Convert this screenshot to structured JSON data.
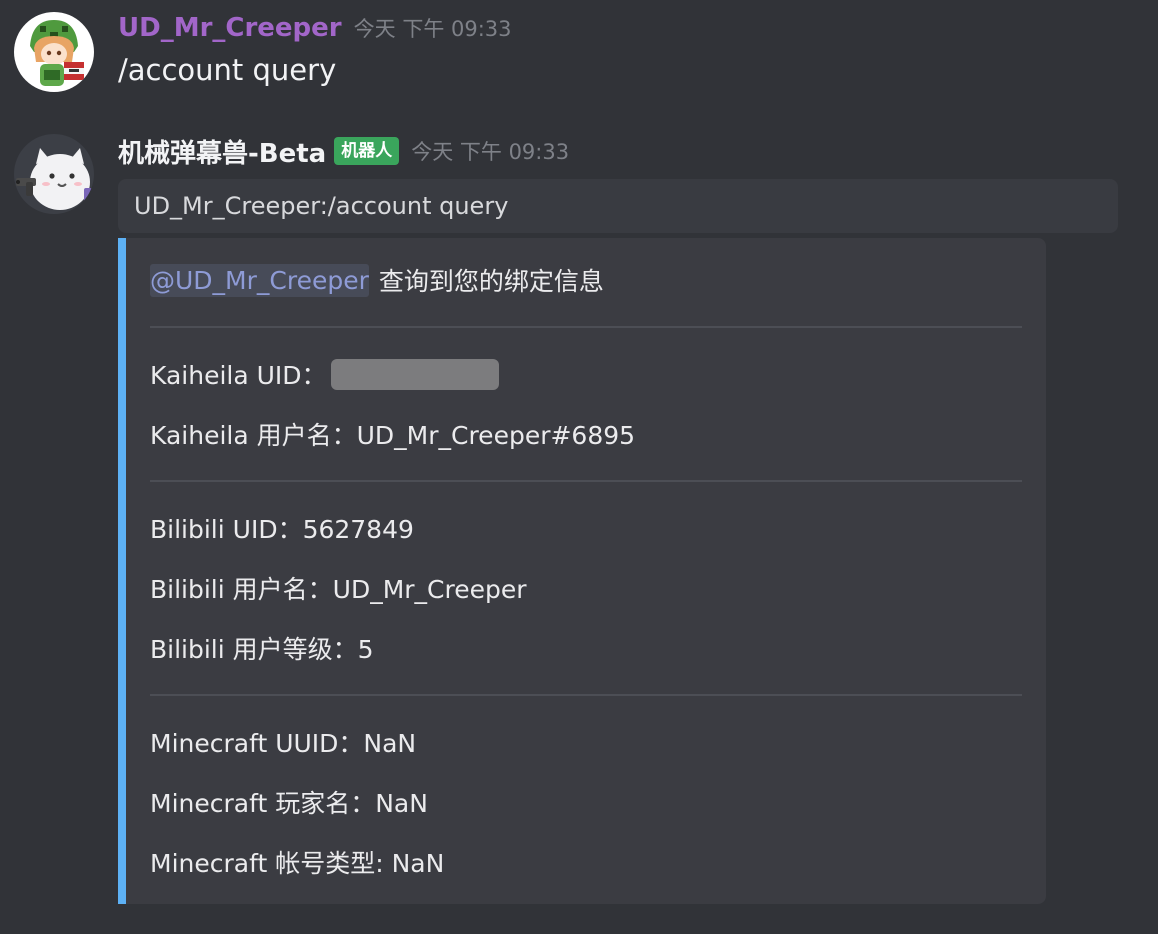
{
  "messages": [
    {
      "username": "UD_Mr_Creeper",
      "time": "今天 下午 09:33",
      "text": "/account query",
      "avatar_icon": "creeper-anime-avatar-icon"
    },
    {
      "username": "机械弹幕兽-Beta",
      "bot_tag": "机器人",
      "time": "今天 下午 09:33",
      "quote": "UD_Mr_Creeper:/account query",
      "avatar_icon": "white-cat-with-gun-avatar-icon"
    }
  ],
  "card": {
    "mention": "@UD_Mr_Creeper",
    "header_text": "查询到您的绑定信息",
    "kaiheila_uid_label": "Kaiheila UID：",
    "kaiheila_name": "Kaiheila 用户名：UD_Mr_Creeper#6895",
    "bilibili_uid": "Bilibili UID：5627849",
    "bilibili_name": "Bilibili 用户名：UD_Mr_Creeper",
    "bilibili_level": "Bilibili 用户等级：5",
    "minecraft_uuid": "Minecraft UUID：NaN",
    "minecraft_name": "Minecraft 玩家名：NaN",
    "minecraft_type": "Minecraft 帐号类型: NaN"
  },
  "colors": {
    "background": "#313338",
    "card_accent": "#5db1f5",
    "bot_tag": "#3aa55c",
    "username_user": "#a266c9",
    "mention": "#8e9bd6"
  }
}
